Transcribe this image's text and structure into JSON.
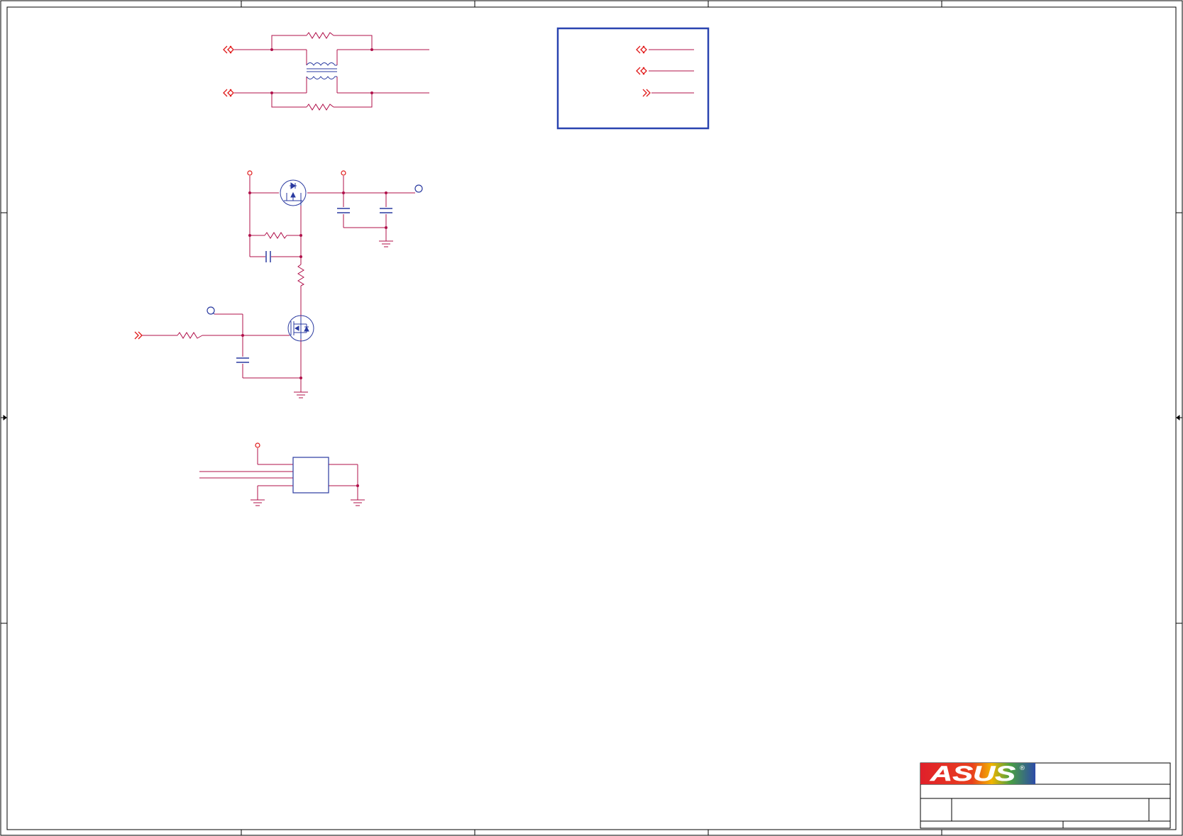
{
  "drawing": {
    "title_block": {
      "logo_text": "ASUS",
      "registered_mark": "®",
      "colors": {
        "logo_red": "#e0202a",
        "logo_blue": "#2d4ba8",
        "logo_gradient_mid": "#f2b400"
      }
    },
    "colors": {
      "wire": "#b0104a",
      "component": "#2a3aa0",
      "port": "#e01818",
      "frame": "#000000",
      "box": "#2a44b0"
    },
    "icons": {
      "bidirectional_port": "double-chevron-port-icon",
      "input_port": "chevron-input-port-icon",
      "ground": "ground-icon",
      "power_pin": "power-pin-icon",
      "test_point": "test-point-icon",
      "mosfet": "mosfet-icon"
    }
  }
}
